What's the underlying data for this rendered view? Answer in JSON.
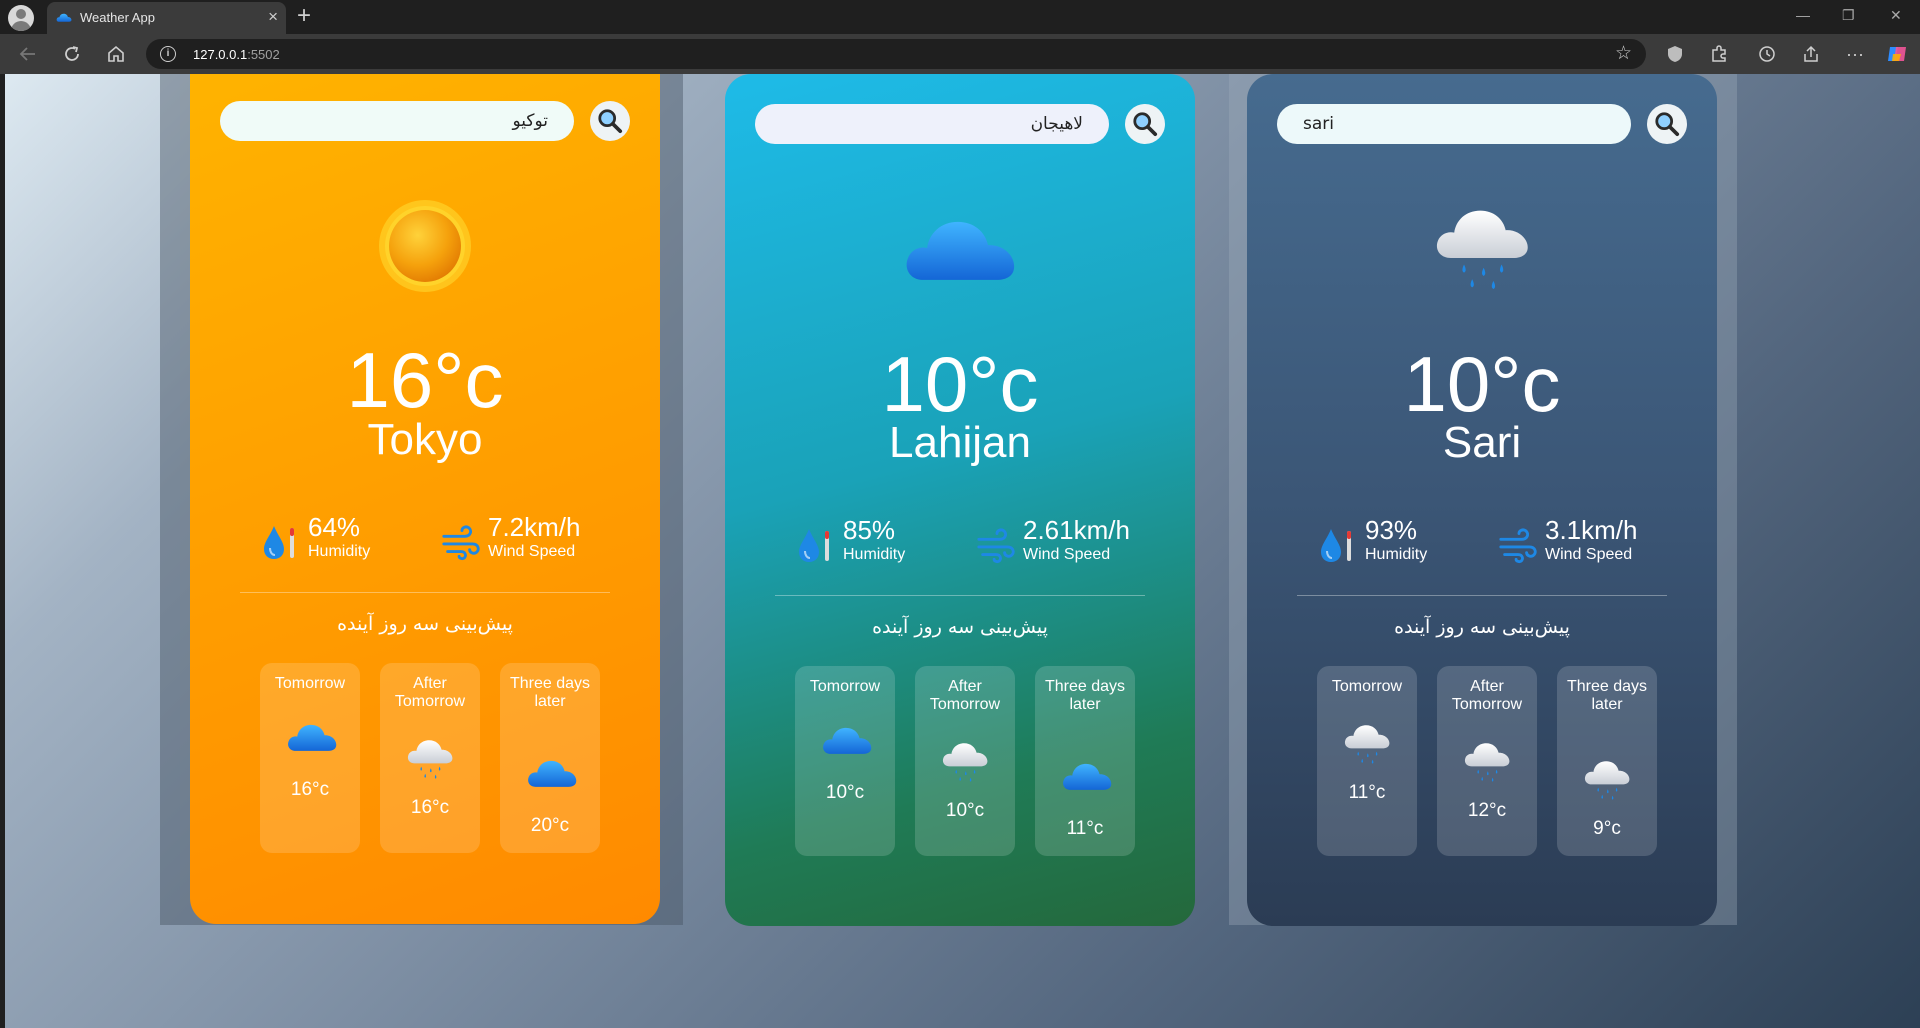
{
  "browser": {
    "tab_title": "Weather App",
    "tab_close": "×",
    "new_tab": "+",
    "url_host": "127.0.0.1",
    "url_port": ":5502",
    "info": "i",
    "win_minimize": "—",
    "win_restore": "❐",
    "win_close": "✕"
  },
  "cards": [
    {
      "theme": "sunny",
      "search_value": "توکیو",
      "main_icon": "sun-icon",
      "temp": "16°c",
      "city": "Tokyo",
      "humidity": "64%",
      "humidity_label": "Humidity",
      "wind": "7.2km/h",
      "wind_label": "Wind Speed",
      "forecast_title": "پیش‌بینی سه روز آینده",
      "forecast": [
        {
          "day": "Tomorrow",
          "icon": "cloud-icon",
          "temp": "16°c"
        },
        {
          "day": "After Tomorrow",
          "icon": "rain-cloud-icon",
          "temp": "16°c"
        },
        {
          "day": "Three days later",
          "icon": "cloud-icon",
          "temp": "20°c"
        }
      ]
    },
    {
      "theme": "cloudy",
      "search_value": "لاهیجان",
      "main_icon": "cloud-icon",
      "temp": "10°c",
      "city": "Lahijan",
      "humidity": "85%",
      "humidity_label": "Humidity",
      "wind": "2.61km/h",
      "wind_label": "Wind Speed",
      "forecast_title": "پیش‌بینی سه روز آینده",
      "forecast": [
        {
          "day": "Tomorrow",
          "icon": "cloud-icon",
          "temp": "10°c"
        },
        {
          "day": "After Tomorrow",
          "icon": "rain-cloud-icon",
          "temp": "10°c"
        },
        {
          "day": "Three days later",
          "icon": "cloud-icon",
          "temp": "11°c"
        }
      ]
    },
    {
      "theme": "rainy",
      "search_value": "sari",
      "main_icon": "rain-cloud-icon",
      "temp": "10°c",
      "city": "Sari",
      "humidity": "93%",
      "humidity_label": "Humidity",
      "wind": "3.1km/h",
      "wind_label": "Wind Speed",
      "forecast_title": "پیش‌بینی سه روز آینده",
      "forecast": [
        {
          "day": "Tomorrow",
          "icon": "rain-cloud-icon",
          "temp": "11°c"
        },
        {
          "day": "After Tomorrow",
          "icon": "rain-cloud-icon",
          "temp": "12°c"
        },
        {
          "day": "Three days later",
          "icon": "rain-cloud-icon",
          "temp": "9°c"
        }
      ]
    }
  ],
  "colors": {
    "sunny_card": "#ffa000",
    "cloudy_card": "#1aa2b8",
    "rainy_card": "#3b5676",
    "cloud_blue": "#1e88e5",
    "sun_orange": "#f39c12"
  }
}
